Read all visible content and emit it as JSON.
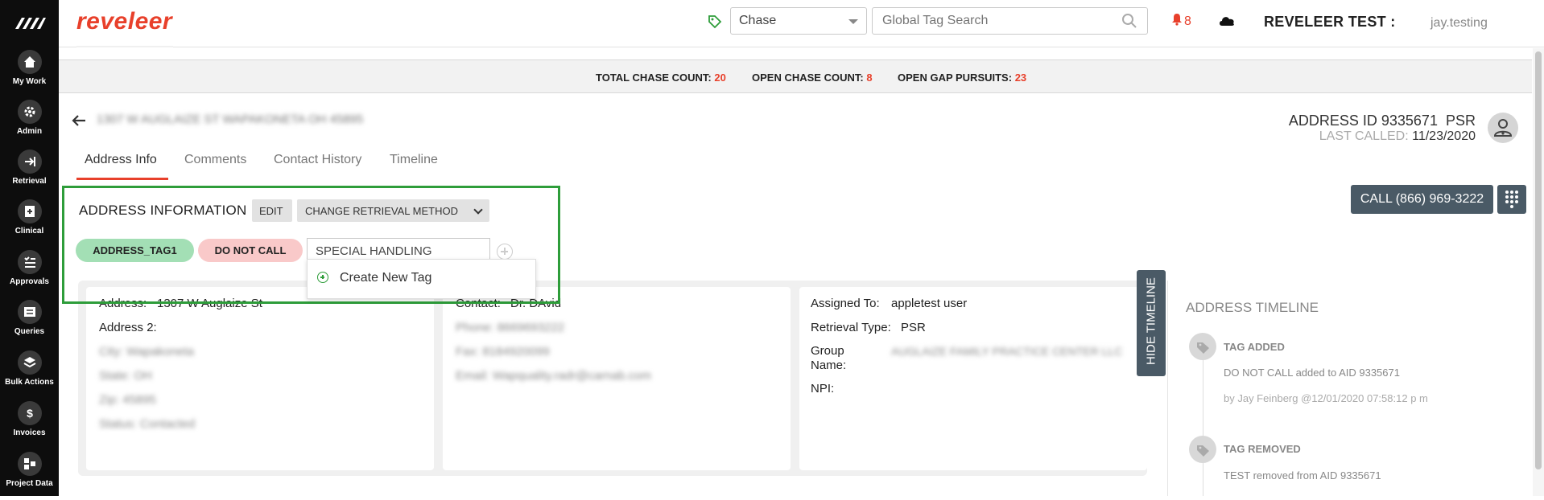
{
  "nav": {
    "items": [
      {
        "label": "My Work",
        "icon": "home-icon"
      },
      {
        "label": "Admin",
        "icon": "gear-icon"
      },
      {
        "label": "Retrieval",
        "icon": "retrieval-icon"
      },
      {
        "label": "Clinical",
        "icon": "clinical-icon"
      },
      {
        "label": "Approvals",
        "icon": "approvals-icon"
      },
      {
        "label": "Queries",
        "icon": "queries-icon"
      },
      {
        "label": "Bulk Actions",
        "icon": "layers-icon"
      },
      {
        "label": "Invoices",
        "icon": "dollar-icon"
      },
      {
        "label": "Project Data",
        "icon": "project-data-icon"
      }
    ]
  },
  "header": {
    "brand": "reveleer",
    "chase_select": "Chase",
    "search_placeholder": "Global Tag Search",
    "notification_count": "8",
    "org": "REVELEER TEST :",
    "user": "jay.testing"
  },
  "counts": {
    "total_label": "TOTAL CHASE COUNT:",
    "total_value": "20",
    "open_label": "OPEN CHASE COUNT:",
    "open_value": "8",
    "gap_label": "OPEN GAP PURSUITS:",
    "gap_value": "23"
  },
  "page": {
    "blurred_title": "1307 W AUGLAIZE ST WAPAKONETA OH 45895",
    "address_id": "ADDRESS ID 9335671",
    "address_type": "PSR",
    "last_called_label": "LAST CALLED:",
    "last_called_value": "11/23/2020",
    "tabs": [
      "Address Info",
      "Comments",
      "Contact History",
      "Timeline"
    ],
    "call_button": "CALL (866) 969-3222"
  },
  "address_info": {
    "title": "ADDRESS INFORMATION",
    "edit_label": "EDIT",
    "change_method_label": "CHANGE RETRIEVAL METHOD",
    "tags": [
      "ADDRESS_TAG1",
      "DO NOT CALL"
    ],
    "tag_input_value": "SPECIAL HANDLING",
    "create_tag_label": "Create New Tag"
  },
  "card_address": {
    "address_label": "Address:",
    "address_value": "1307 W Auglaize St",
    "address2_label": "Address 2:",
    "city": "City: Wapakoneta",
    "state": "State: OH",
    "zip": "Zip: 45895",
    "status": "Status: Contacted"
  },
  "card_contact": {
    "contact_label": "Contact:",
    "contact_value": "Dr. DAvid",
    "phone": "Phone: 8669693222",
    "fax": "Fax: 8184920099",
    "email": "Email: Wapquality.radr@carnab.com"
  },
  "card_assignment": {
    "assigned_label": "Assigned To:",
    "assigned_value": "appletest user",
    "retrieval_label": "Retrieval Type:",
    "retrieval_value": "PSR",
    "group_label_1": "Group",
    "group_label_2": "Name:",
    "group_value": "AUGLAIZE FAMILY PRACTICE CENTER LLC",
    "npi_label": "NPI:"
  },
  "timeline": {
    "toggle_label": "HIDE TIMELINE",
    "title": "ADDRESS TIMELINE",
    "events": [
      {
        "head": "TAG ADDED",
        "text": "DO NOT CALL added to AID 9335671",
        "meta": "by Jay Feinberg @12/01/2020 07:58:12 p m"
      },
      {
        "head": "TAG REMOVED",
        "text": "TEST removed from AID 9335671"
      }
    ]
  },
  "colors": {
    "brand": "#e8402b",
    "accent_button": "#4a5a66",
    "highlight_box": "#2e9d3a",
    "tag_green": "#a3dfb5",
    "tag_red": "#f9c9c9"
  }
}
